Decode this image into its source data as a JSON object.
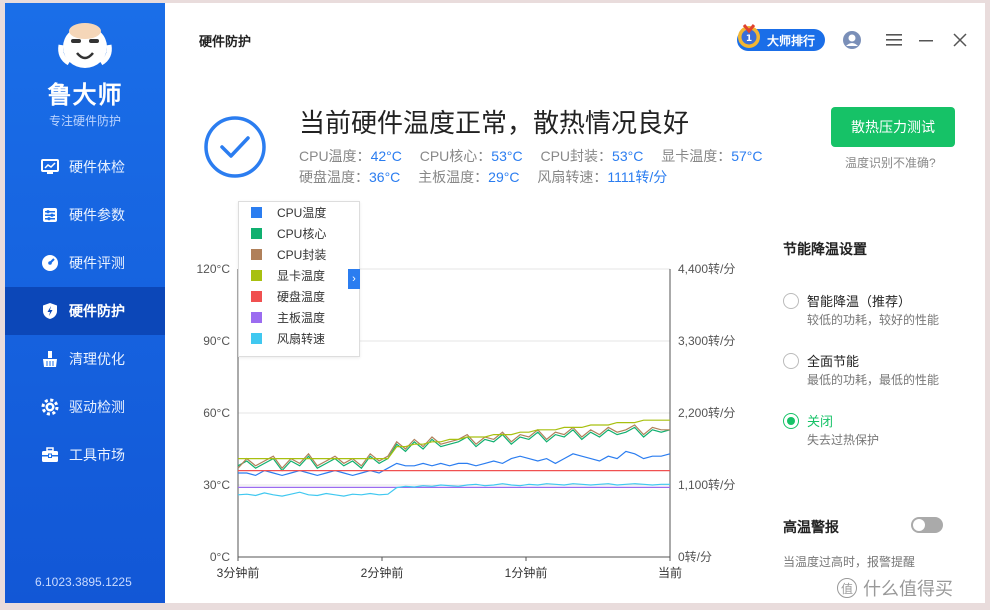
{
  "sidebar": {
    "app_name": "鲁大师",
    "app_sub": "专注硬件防护",
    "items": [
      {
        "label": "硬件体检",
        "icon": "monitor-icon"
      },
      {
        "label": "硬件参数",
        "icon": "sliders-icon"
      },
      {
        "label": "硬件评测",
        "icon": "gauge-icon"
      },
      {
        "label": "硬件防护",
        "icon": "shield-icon"
      },
      {
        "label": "清理优化",
        "icon": "broom-icon"
      },
      {
        "label": "驱动检测",
        "icon": "gear-icon"
      },
      {
        "label": "工具市场",
        "icon": "toolbox-icon"
      }
    ],
    "active_index": 3,
    "version": "6.1023.3895.1225"
  },
  "header": {
    "title": "硬件防护",
    "rank_label": "大师排行"
  },
  "status": {
    "headline": "当前硬件温度正常，散热情况良好",
    "row1": [
      {
        "label": "CPU温度：",
        "value": "42°C"
      },
      {
        "label": "CPU核心：",
        "value": "53°C"
      },
      {
        "label": "CPU封装：",
        "value": "53°C"
      },
      {
        "label": "显卡温度：",
        "value": "57°C"
      }
    ],
    "row2": [
      {
        "label": "硬盘温度：",
        "value": "36°C"
      },
      {
        "label": "主板温度：",
        "value": "29°C"
      },
      {
        "label": "风扇转速：",
        "value": "1111转/分"
      }
    ],
    "stress_button": "散热压力测试",
    "stress_hint": "温度识别不准确?"
  },
  "chart_data": {
    "type": "line",
    "x_ticks": [
      "3分钟前",
      "2分钟前",
      "1分钟前",
      "当前"
    ],
    "y_left_ticks": [
      "0°C",
      "30°C",
      "60°C",
      "90°C",
      "120°C"
    ],
    "y_right_ticks": [
      "0转/分",
      "1,100转/分",
      "2,200转/分",
      "3,300转/分",
      "4,400转/分"
    ],
    "y_left_range": [
      0,
      120
    ],
    "y_right_range": [
      0,
      4400
    ],
    "grid": true,
    "legend": "top-left",
    "series": [
      {
        "name": "CPU温度",
        "color": "#2b7df0",
        "values": [
          35,
          35,
          34,
          36,
          35,
          34,
          35,
          36,
          35,
          34,
          35,
          36,
          35,
          34,
          35,
          36,
          35,
          37,
          39,
          38,
          38,
          39,
          38,
          39,
          38,
          39,
          39,
          38,
          39,
          40,
          39,
          41,
          42,
          41,
          40,
          41,
          39,
          41,
          43,
          42,
          41,
          40,
          42,
          41,
          44,
          43,
          41,
          42,
          42,
          43
        ]
      },
      {
        "name": "CPU核心",
        "color": "#10b070",
        "values": [
          38,
          40,
          37,
          39,
          41,
          36,
          40,
          38,
          42,
          37,
          39,
          41,
          38,
          40,
          37,
          42,
          39,
          41,
          47,
          44,
          48,
          45,
          49,
          46,
          47,
          48,
          50,
          46,
          49,
          48,
          51,
          47,
          50,
          49,
          52,
          48,
          51,
          50,
          53,
          49,
          52,
          50,
          53,
          51,
          52,
          54,
          50,
          53,
          52,
          53
        ]
      },
      {
        "name": "CPU封装",
        "color": "#b0805a",
        "values": [
          37,
          41,
          38,
          40,
          42,
          37,
          41,
          39,
          43,
          38,
          40,
          42,
          39,
          41,
          38,
          43,
          40,
          42,
          48,
          45,
          49,
          46,
          50,
          47,
          48,
          49,
          51,
          47,
          50,
          49,
          52,
          48,
          51,
          50,
          53,
          49,
          52,
          51,
          54,
          50,
          53,
          51,
          54,
          52,
          53,
          55,
          51,
          54,
          53,
          53
        ]
      },
      {
        "name": "显卡温度",
        "color": "#a8c010",
        "values": [
          41,
          41,
          41,
          41,
          41,
          41,
          41,
          41,
          41,
          41,
          41,
          41,
          41,
          41,
          41,
          41,
          41,
          41,
          46,
          46,
          47,
          47,
          48,
          48,
          49,
          49,
          50,
          50,
          50,
          51,
          51,
          51,
          52,
          52,
          53,
          53,
          53,
          54,
          54,
          54,
          55,
          55,
          55,
          56,
          56,
          56,
          57,
          57,
          57,
          57
        ]
      },
      {
        "name": "硬盘温度",
        "color": "#f05050",
        "values": [
          36,
          36,
          36,
          36,
          36,
          36,
          36,
          36,
          36,
          36,
          36,
          36,
          36,
          36,
          36,
          36,
          36,
          36,
          36,
          36,
          36,
          36,
          36,
          36,
          36,
          36,
          36,
          36,
          36,
          36,
          36,
          36,
          36,
          36,
          36,
          36,
          36,
          36,
          36,
          36,
          36,
          36,
          36,
          36,
          36,
          36,
          36,
          36,
          36,
          36
        ]
      },
      {
        "name": "主板温度",
        "color": "#9b6cf0",
        "values": [
          29,
          29,
          29,
          29,
          29,
          29,
          29,
          29,
          29,
          29,
          29,
          29,
          29,
          29,
          29,
          29,
          29,
          29,
          29,
          29,
          29,
          29,
          29,
          29,
          29,
          29,
          29,
          29,
          29,
          29,
          29,
          29,
          29,
          29,
          29,
          29,
          29,
          29,
          29,
          29,
          29,
          29,
          29,
          29,
          29,
          29,
          29,
          29,
          29,
          29
        ]
      },
      {
        "name": "风扇转速",
        "color": "#40c8f0",
        "values": [
          950,
          960,
          940,
          980,
          950,
          930,
          960,
          990,
          950,
          940,
          970,
          950,
          930,
          960,
          950,
          970,
          950,
          960,
          1060,
          1080,
          1070,
          1090,
          1080,
          1100,
          1090,
          1080,
          1100,
          1110,
          1090,
          1100,
          1120,
          1100,
          1090,
          1110,
          1100,
          1120,
          1110,
          1100,
          1120,
          1110,
          1100,
          1110,
          1120,
          1100,
          1110,
          1120,
          1110,
          1100,
          1110,
          1111
        ]
      }
    ]
  },
  "settings": {
    "title": "节能降温设置",
    "options": [
      {
        "label": "智能降温（推荐）",
        "desc": "较低的功耗，较好的性能",
        "selected": false
      },
      {
        "label": "全面节能",
        "desc": "最低的功耗，最低的性能",
        "selected": false
      },
      {
        "label": "关闭",
        "desc": "失去过热保护",
        "selected": true
      }
    ],
    "alert_title": "高温警报",
    "alert_desc": "当温度过高时，报警提醒",
    "alert_enabled": false
  },
  "watermark": {
    "badge": "值",
    "text": "什么值得买"
  }
}
